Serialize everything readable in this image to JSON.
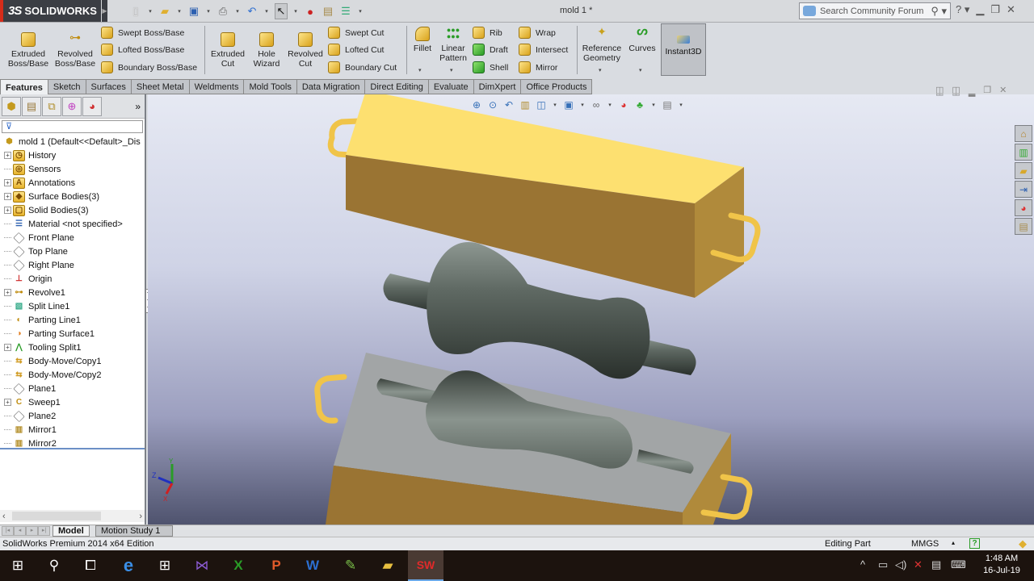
{
  "app": {
    "brand": "SOLIDWORKS",
    "brand_prefix": "3S",
    "document_title": "mold 1 *"
  },
  "search": {
    "placeholder": "Search Community Forum"
  },
  "quick_access": [
    "new-icon",
    "open-icon",
    "save-icon",
    "print-icon",
    "undo-icon",
    "select-icon",
    "rebuild-icon",
    "file-properties-icon",
    "options-icon"
  ],
  "ribbon": {
    "extruded_boss": "Extruded\nBoss/Base",
    "extruded_boss_l1": "Extruded",
    "extruded_boss_l2": "Boss/Base",
    "revolved_boss_l1": "Revolved",
    "revolved_boss_l2": "Boss/Base",
    "swept_boss": "Swept Boss/Base",
    "lofted_boss": "Lofted Boss/Base",
    "boundary_boss": "Boundary Boss/Base",
    "extruded_cut_l1": "Extruded",
    "extruded_cut_l2": "Cut",
    "hole_wizard_l1": "Hole",
    "hole_wizard_l2": "Wizard",
    "revolved_cut_l1": "Revolved",
    "revolved_cut_l2": "Cut",
    "swept_cut": "Swept Cut",
    "lofted_cut": "Lofted Cut",
    "boundary_cut": "Boundary Cut",
    "fillet": "Fillet",
    "linear_pattern_l1": "Linear",
    "linear_pattern_l2": "Pattern",
    "rib": "Rib",
    "draft": "Draft",
    "shell": "Shell",
    "wrap": "Wrap",
    "intersect": "Intersect",
    "mirror": "Mirror",
    "ref_geom_l1": "Reference",
    "ref_geom_l2": "Geometry",
    "curves": "Curves",
    "instant3d": "Instant3D"
  },
  "tabs": [
    {
      "label": "Features",
      "active": true
    },
    {
      "label": "Sketch"
    },
    {
      "label": "Surfaces"
    },
    {
      "label": "Sheet Metal"
    },
    {
      "label": "Weldments"
    },
    {
      "label": "Mold Tools"
    },
    {
      "label": "Data Migration"
    },
    {
      "label": "Direct Editing"
    },
    {
      "label": "Evaluate"
    },
    {
      "label": "DimXpert"
    },
    {
      "label": "Office Products"
    }
  ],
  "feature_tree": {
    "root": "mold 1  (Default<<Default>_Dis",
    "items": [
      {
        "label": "History",
        "expandable": true,
        "icon": "history-icon"
      },
      {
        "label": "Sensors",
        "expandable": false,
        "icon": "sensors-icon"
      },
      {
        "label": "Annotations",
        "expandable": true,
        "icon": "annotations-icon"
      },
      {
        "label": "Surface Bodies(3)",
        "expandable": true,
        "icon": "surface-bodies-icon"
      },
      {
        "label": "Solid Bodies(3)",
        "expandable": true,
        "icon": "solid-bodies-icon"
      },
      {
        "label": "Material <not specified>",
        "expandable": false,
        "icon": "material-icon"
      },
      {
        "label": "Front Plane",
        "expandable": false,
        "icon": "plane-icon"
      },
      {
        "label": "Top Plane",
        "expandable": false,
        "icon": "plane-icon"
      },
      {
        "label": "Right Plane",
        "expandable": false,
        "icon": "plane-icon"
      },
      {
        "label": "Origin",
        "expandable": false,
        "icon": "origin-icon"
      },
      {
        "label": "Revolve1",
        "expandable": true,
        "icon": "revolve-icon"
      },
      {
        "label": "Split Line1",
        "expandable": false,
        "icon": "split-line-icon"
      },
      {
        "label": "Parting Line1",
        "expandable": false,
        "icon": "parting-line-icon"
      },
      {
        "label": "Parting Surface1",
        "expandable": false,
        "icon": "parting-surface-icon"
      },
      {
        "label": "Tooling Split1",
        "expandable": true,
        "icon": "tooling-split-icon"
      },
      {
        "label": "Body-Move/Copy1",
        "expandable": false,
        "icon": "body-move-icon"
      },
      {
        "label": "Body-Move/Copy2",
        "expandable": false,
        "icon": "body-move-icon"
      },
      {
        "label": "Plane1",
        "expandable": false,
        "icon": "plane-icon"
      },
      {
        "label": "Sweep1",
        "expandable": true,
        "icon": "sweep-icon"
      },
      {
        "label": "Plane2",
        "expandable": false,
        "icon": "plane-icon"
      },
      {
        "label": "Mirror1",
        "expandable": false,
        "icon": "mirror-icon"
      },
      {
        "label": "Mirror2",
        "expandable": false,
        "icon": "mirror-icon"
      }
    ]
  },
  "triad": {
    "x": "X",
    "y": "Y",
    "z": "Z"
  },
  "bottom_tabs": {
    "model": "Model",
    "motion": "Motion Study 1"
  },
  "status": {
    "edition": "SolidWorks Premium 2014 x64 Edition",
    "mode": "Editing Part",
    "units": "MMGS"
  },
  "clock": {
    "time": "1:48 AM",
    "date": "16-Jul-19"
  },
  "colors": {
    "mold_top": "#fde070",
    "mold_side": "#9a7433",
    "core": "#6d7770",
    "cavity": "#a0a3a4",
    "handle": "#f3c549"
  }
}
